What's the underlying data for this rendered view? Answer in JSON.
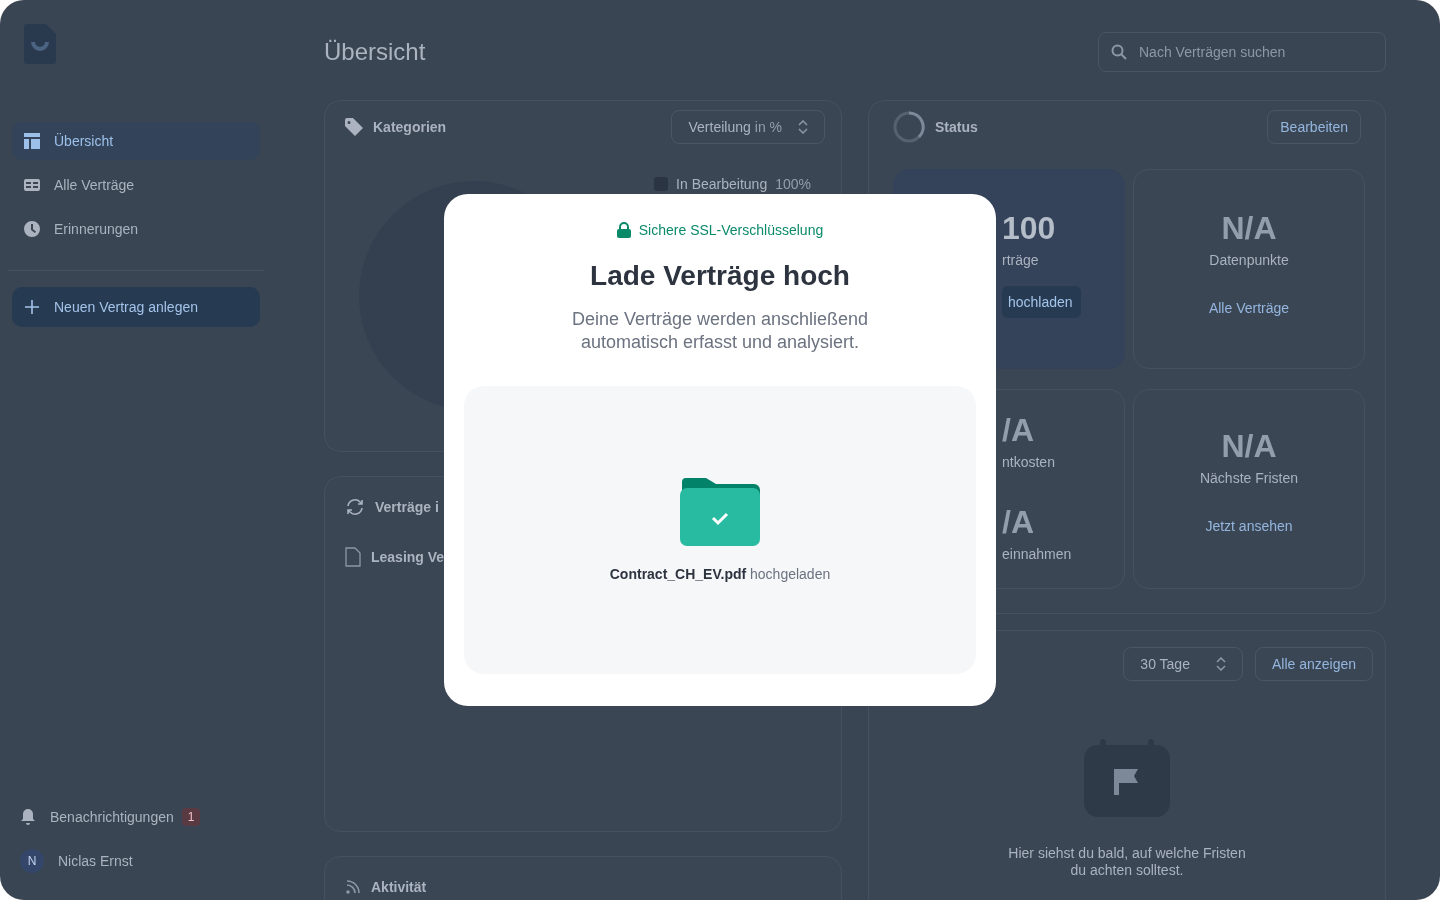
{
  "sidebar": {
    "nav": [
      {
        "label": "Übersicht",
        "selected": true
      },
      {
        "label": "Alle Verträge",
        "selected": false
      },
      {
        "label": "Erinnerungen",
        "selected": false
      }
    ],
    "new_button": "Neuen Vertrag anlegen",
    "notifications": {
      "label": "Benachrichtigungen",
      "badge": "1"
    },
    "user": {
      "initial": "N",
      "name": "Niclas Ernst"
    }
  },
  "header": {
    "title": "Übersicht",
    "search": {
      "placeholder": "Nach Verträgen suchen"
    }
  },
  "categories_card": {
    "title": "Kategorien",
    "select": {
      "value": "Verteilung",
      "suffix": "in %"
    },
    "legend": [
      {
        "label": "In Bearbeitung",
        "value": "100%"
      }
    ]
  },
  "contracts_card": {
    "title": "Verträge i",
    "rows": [
      "Leasing Ve"
    ]
  },
  "activity_card": {
    "title": "Aktivität"
  },
  "status_card": {
    "title": "Status",
    "edit_button": "Bearbeiten",
    "stats": [
      {
        "kind": "action",
        "highlighted": true,
        "items": [
          {
            "value": "100",
            "label": "rträge"
          }
        ],
        "action": "hochladen"
      },
      {
        "kind": "link",
        "highlighted": false,
        "items": [
          {
            "value": "N/A",
            "label": "Datenpunkte"
          }
        ],
        "action": "Alle Verträge"
      },
      {
        "kind": "plain",
        "highlighted": false,
        "items": [
          {
            "value": "/A",
            "label": "ntkosten"
          },
          {
            "value": "/A",
            "label": "einnahmen"
          }
        ]
      },
      {
        "kind": "link",
        "highlighted": false,
        "items": [
          {
            "value": "N/A",
            "label": "Nächste Fristen"
          }
        ],
        "action": "Jetzt ansehen"
      }
    ]
  },
  "deadlines_card": {
    "range_select": "30 Tage",
    "show_all_button": "Alle anzeigen",
    "empty_text": "Hier siehst du bald, auf welche Fristen du achten solltest."
  },
  "upload_modal": {
    "security_note": "Sichere SSL-Verschlüsselung",
    "title": "Lade Verträge hoch",
    "subtitle": "Deine Verträge werden anschließend automatisch erfasst und analysiert.",
    "dropzone": {
      "status": "**Contract_CH_EV.pdf** hochgeladen"
    }
  }
}
